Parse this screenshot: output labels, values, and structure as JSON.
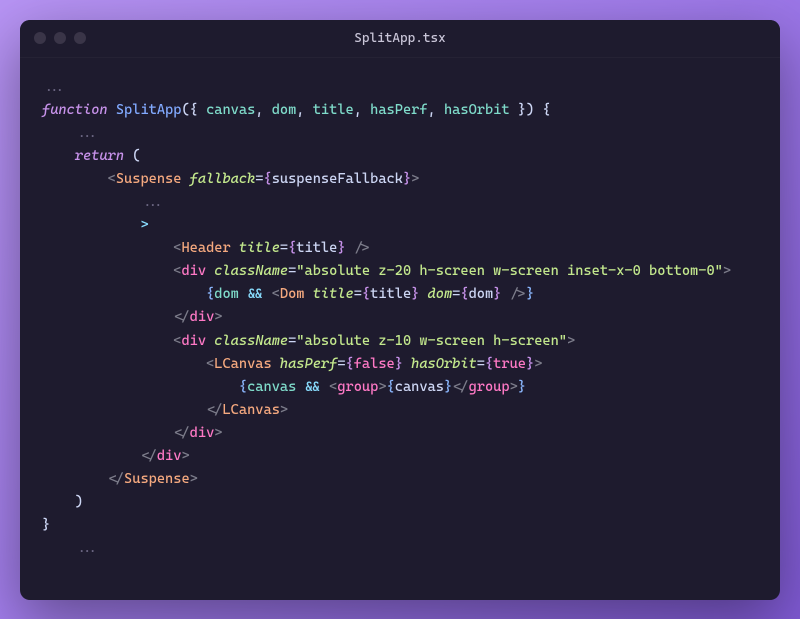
{
  "window": {
    "title": "SplitApp.tsx"
  },
  "code": {
    "ellipsis": "...",
    "fn_keyword": "function",
    "fn_name": "SplitApp",
    "destructure_open": "({ ",
    "params": {
      "canvas": "canvas",
      "dom": "dom",
      "title": "title",
      "hasPerf": "hasPerf",
      "hasOrbit": "hasOrbit"
    },
    "destructure_close": " }) {",
    "comma": ", ",
    "return_kw": "return",
    "return_paren": " (",
    "suspense_open_lt": "<",
    "suspense_name": "Suspense",
    "fallback_attr": "fallback",
    "eq": "=",
    "brace_l": "{",
    "brace_r": "}",
    "suspense_fallback": "suspenseFallback",
    "gt": ">",
    "lone_gt": ">",
    "header_name": "Header",
    "title_attr": "title",
    "title_val": "title",
    "self_close": " />",
    "div_name": "div",
    "className_attr": "className",
    "class_str1": "\"absolute z-20 h-screen w-screen inset-x-0 bottom-0\"",
    "dom_var": "dom",
    "and_op": " && ",
    "dom_name": "Dom",
    "dom_attr": "dom",
    "div_close": "</",
    "class_str2": "\"absolute z-10 w-screen h-screen\"",
    "lcanvas_name": "LCanvas",
    "hasPerf_attr": "hasPerf",
    "false_val": "false",
    "hasOrbit_attr": "hasOrbit",
    "true_val": "true",
    "canvas_var": "canvas",
    "group_name": "group",
    "close_paren": ")",
    "close_brace": "}"
  }
}
